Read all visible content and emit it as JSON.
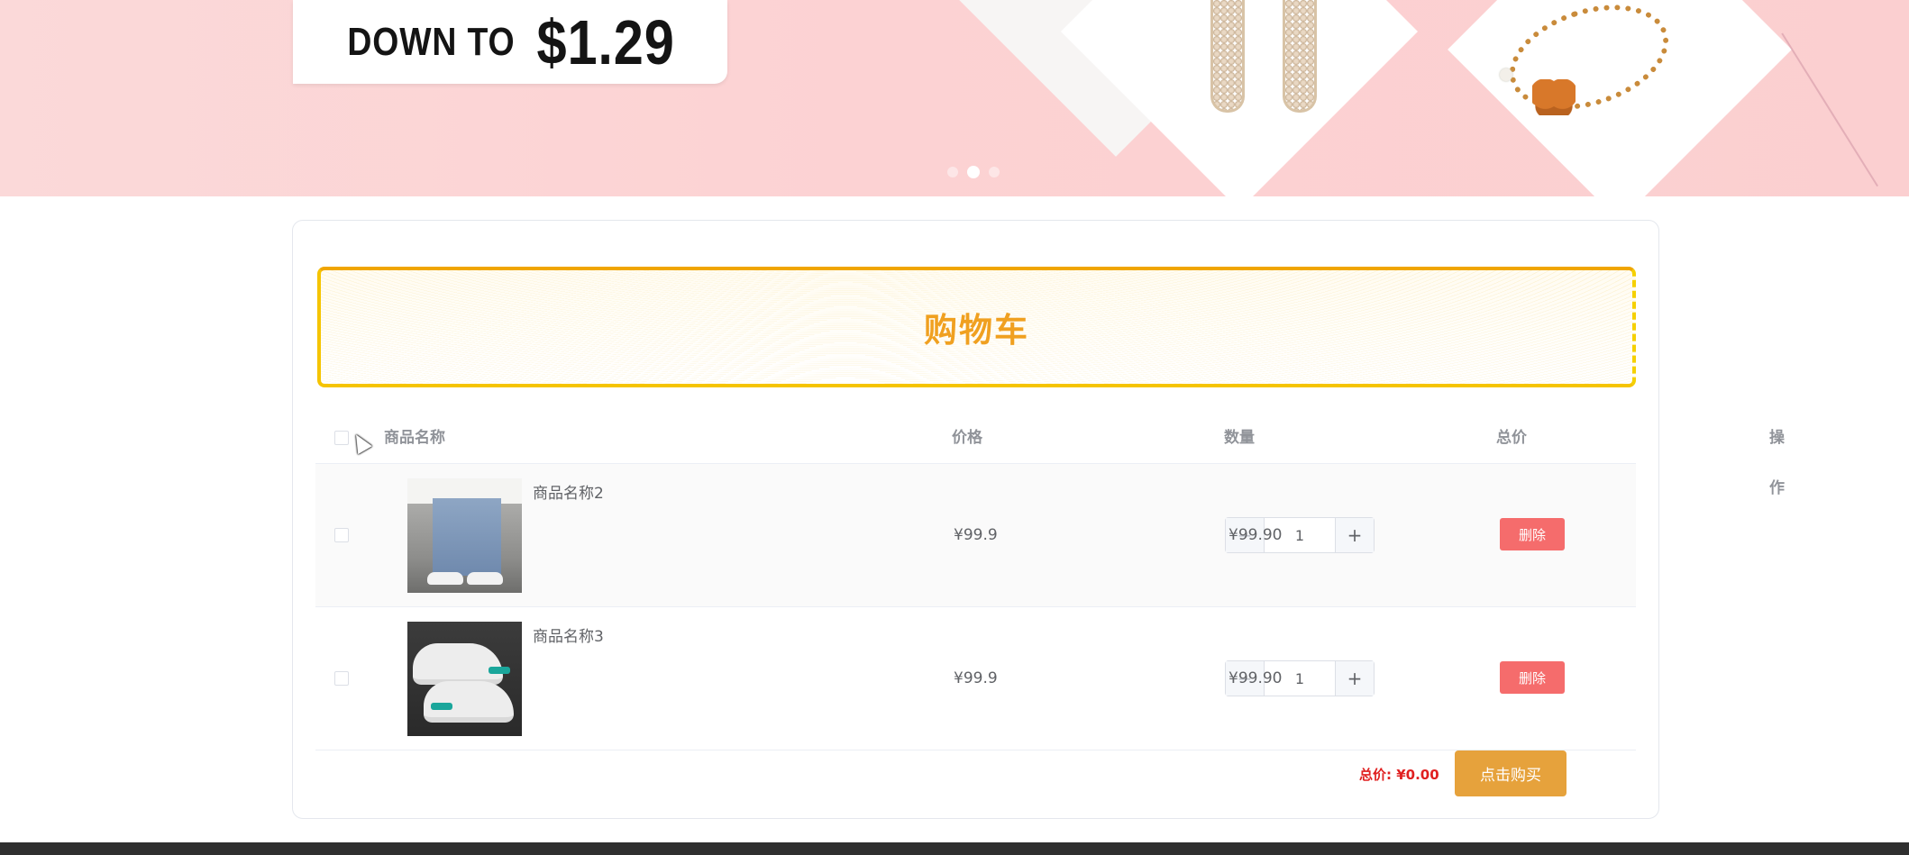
{
  "banner": {
    "promo_prefix": "DOWN TO",
    "promo_price": "$1.29",
    "slide_count": 3,
    "active_slide": 2
  },
  "cart": {
    "title": "购物车",
    "columns": {
      "name": "商品名称",
      "price": "价格",
      "quantity": "数量",
      "total": "总价",
      "action": "操作"
    },
    "items": [
      {
        "name": "商品名称2",
        "price": "¥99.9",
        "quantity": "1",
        "total": "¥99.90",
        "delete_label": "删除",
        "thumbnail": "jeans-photo"
      },
      {
        "name": "商品名称3",
        "price": "¥99.9",
        "quantity": "1",
        "total": "¥99.90",
        "delete_label": "删除",
        "thumbnail": "sneaker-photo"
      }
    ],
    "summary_label": "总价: ¥0.00",
    "buy_label": "点击购买"
  },
  "colors": {
    "title": "#f0a020",
    "delete": "#f56c6c",
    "buy": "#e6a23c",
    "summary": "#e02020"
  }
}
